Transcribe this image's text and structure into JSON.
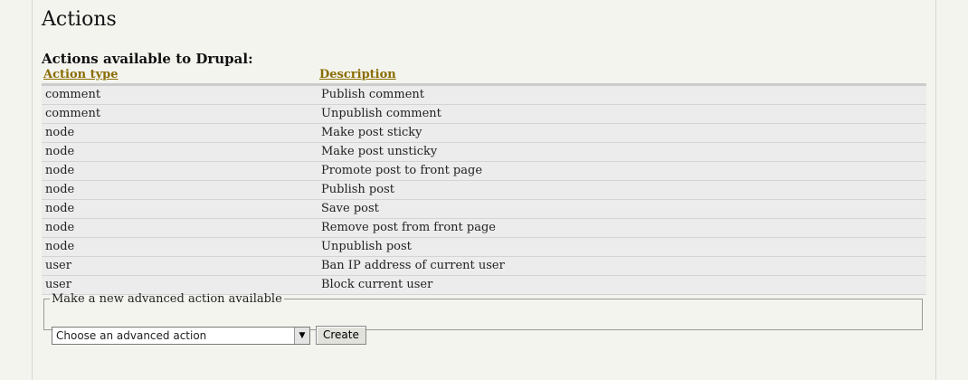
{
  "page": {
    "title": "Actions",
    "subtitle": "Actions available to Drupal:"
  },
  "table": {
    "headers": [
      "Action type",
      "Description"
    ],
    "rows": [
      [
        "comment",
        "Publish comment"
      ],
      [
        "comment",
        "Unpublish comment"
      ],
      [
        "node",
        "Make post sticky"
      ],
      [
        "node",
        "Make post unsticky"
      ],
      [
        "node",
        "Promote post to front page"
      ],
      [
        "node",
        "Publish post"
      ],
      [
        "node",
        "Save post"
      ],
      [
        "node",
        "Remove post from front page"
      ],
      [
        "node",
        "Unpublish post"
      ],
      [
        "user",
        "Ban IP address of current user"
      ],
      [
        "user",
        "Block current user"
      ]
    ]
  },
  "advanced": {
    "legend": "Make a new advanced action available",
    "select_value": "Choose an advanced action",
    "button_label": "Create"
  },
  "icons": {
    "dropdown": "chevron-down-icon"
  },
  "colors": {
    "link": "#8a6d00",
    "row_bg": "#ececec",
    "page_bg": "#f4f4ef"
  }
}
